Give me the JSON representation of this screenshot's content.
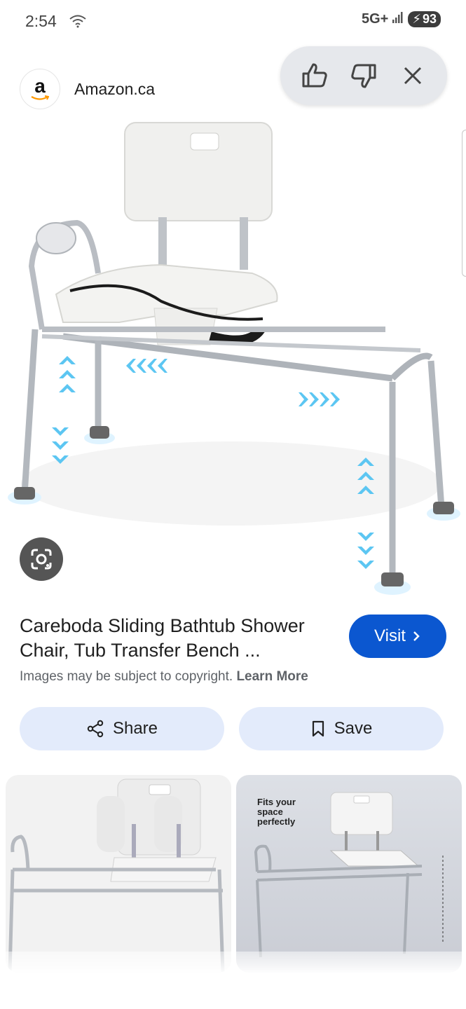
{
  "status_bar": {
    "time": "2:54",
    "network": "5G+",
    "battery": "93"
  },
  "source": {
    "favicon_letter": "a",
    "name": "Amazon.ca"
  },
  "feedback": {
    "icons": [
      "thumbs-up-icon",
      "thumbs-down-icon",
      "close-icon"
    ]
  },
  "result": {
    "title": "Careboda Sliding Bathtub Shower Chair, Tub Transfer Bench ...",
    "visit_label": "Visit",
    "copyright_text": "Images may be subject to copyright.",
    "learn_more": "Learn More"
  },
  "actions": {
    "share_label": "Share",
    "save_label": "Save"
  },
  "related": {
    "thumb2_caption": "Fits your space perfectly"
  },
  "colors": {
    "accent": "#0b57d0",
    "action_bg": "#e3ebfb",
    "pill_bg": "#e6e8ec"
  }
}
